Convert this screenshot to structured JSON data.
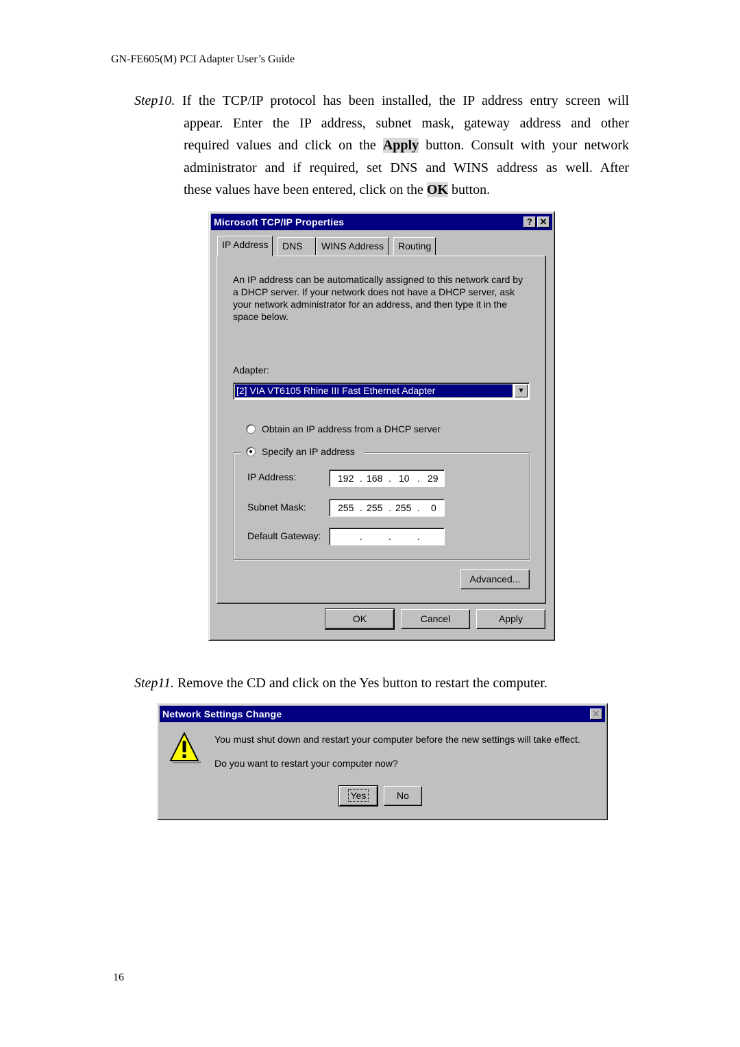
{
  "document": {
    "running_head": "GN-FE605(M) PCI Adapter User’s Guide",
    "page_number": "16",
    "step10": {
      "label": "Step10.",
      "line1_rest": " If the TCP/IP protocol has been installed, the IP address entry screen will",
      "line2": "appear. Enter the IP address, subnet mask, gateway address and other",
      "line3_a": "required values and click on the ",
      "line3_bold": "Apply",
      "line3_b": " button. Consult with your network",
      "line4": "administrator and if required, set DNS and WINS address as well. After",
      "line5_a": "these values have been entered, click on the ",
      "line5_bold": "OK",
      "line5_b": " button."
    },
    "step11": {
      "label": "Step11.",
      "text": " Remove the CD and click on the Yes button to restart the computer."
    }
  },
  "tcpip_dialog": {
    "title": "Microsoft TCP/IP Properties",
    "help_glyph": "?",
    "close_glyph": "✕",
    "tabs": [
      {
        "label": "IP Address",
        "active": true
      },
      {
        "label": "DNS",
        "active": false
      },
      {
        "label": "WINS Address",
        "active": false
      },
      {
        "label": "Routing",
        "active": false
      }
    ],
    "description": "An IP address can be automatically assigned to this network card by a DHCP server.  If your network does not have a DHCP server, ask your network administrator for an address, and then type it in the space below.",
    "adapter_label": "Adapter:",
    "adapter_value": "[2] VIA VT6105 Rhine III Fast Ethernet Adapter",
    "dropdown_glyph": "▼",
    "radio_dhcp": {
      "label": "Obtain an IP address from a DHCP server",
      "selected": false
    },
    "radio_specify": {
      "label": "Specify an IP address",
      "selected": true
    },
    "fields": {
      "ip_address": {
        "label": "IP Address:",
        "octets": [
          "192",
          "168",
          "10",
          "29"
        ]
      },
      "subnet_mask": {
        "label": "Subnet Mask:",
        "octets": [
          "255",
          "255",
          "255",
          "0"
        ]
      },
      "default_gateway": {
        "label": "Default Gateway:",
        "octets": [
          "",
          "",
          "",
          ""
        ]
      }
    },
    "advanced_label": "Advanced...",
    "ok_label": "OK",
    "cancel_label": "Cancel",
    "apply_label": "Apply"
  },
  "restart_dialog": {
    "title": "Network Settings Change",
    "close_glyph": "✕",
    "icon": "warning-icon",
    "message1": "You must shut down and restart your computer before the new settings will take effect.",
    "message2": "Do you want to restart your computer now?",
    "yes_label": "Yes",
    "no_label": "No"
  },
  "colors": {
    "titlebar": "#000080",
    "dialog_face": "#c0c0c0",
    "highlight_bg": "#d9d9d9",
    "warning_yellow": "#ffff00"
  }
}
